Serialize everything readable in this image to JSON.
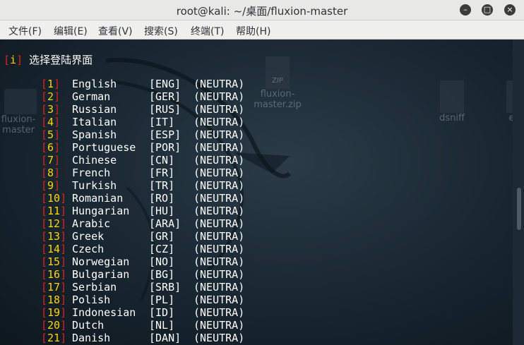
{
  "window": {
    "title": "root@kali: ~/桌面/fluxion-master"
  },
  "menu": [
    "文件(F)",
    "编辑(E)",
    "查看(V)",
    "搜索(S)",
    "终端(T)",
    "帮助(H)"
  ],
  "desktop_icons": [
    {
      "label": "fluxion-master"
    },
    {
      "label": "fluxion-master.zip"
    },
    {
      "label": "dsniff"
    },
    {
      "label": "et"
    }
  ],
  "terminal": {
    "header": {
      "tag": "i",
      "text": "选择登陆界面"
    },
    "languages": [
      {
        "num": "1",
        "name": "English",
        "code": "[ENG]",
        "status": "(NEUTRA)"
      },
      {
        "num": "2",
        "name": "German",
        "code": "[GER]",
        "status": "(NEUTRA)"
      },
      {
        "num": "3",
        "name": "Russian",
        "code": "[RUS]",
        "status": "(NEUTRA)"
      },
      {
        "num": "4",
        "name": "Italian",
        "code": "[IT]",
        "status": "(NEUTRA)"
      },
      {
        "num": "5",
        "name": "Spanish",
        "code": "[ESP]",
        "status": "(NEUTRA)"
      },
      {
        "num": "6",
        "name": "Portuguese",
        "code": "[POR]",
        "status": "(NEUTRA)"
      },
      {
        "num": "7",
        "name": "Chinese",
        "code": "[CN]",
        "status": "(NEUTRA)"
      },
      {
        "num": "8",
        "name": "French",
        "code": "[FR]",
        "status": "(NEUTRA)"
      },
      {
        "num": "9",
        "name": "Turkish",
        "code": "[TR]",
        "status": "(NEUTRA)"
      },
      {
        "num": "10",
        "name": "Romanian",
        "code": "[RO]",
        "status": "(NEUTRA)"
      },
      {
        "num": "11",
        "name": "Hungarian",
        "code": "[HU]",
        "status": "(NEUTRA)"
      },
      {
        "num": "12",
        "name": "Arabic",
        "code": "[ARA]",
        "status": "(NEUTRA)"
      },
      {
        "num": "13",
        "name": "Greek",
        "code": "[GR]",
        "status": "(NEUTRA)"
      },
      {
        "num": "14",
        "name": "Czech",
        "code": "[CZ]",
        "status": "(NEUTRA)"
      },
      {
        "num": "15",
        "name": "Norwegian",
        "code": "[NO]",
        "status": "(NEUTRA)"
      },
      {
        "num": "16",
        "name": "Bulgarian",
        "code": "[BG]",
        "status": "(NEUTRA)"
      },
      {
        "num": "17",
        "name": "Serbian",
        "code": "[SRB]",
        "status": "(NEUTRA)"
      },
      {
        "num": "18",
        "name": "Polish",
        "code": "[PL]",
        "status": "(NEUTRA)"
      },
      {
        "num": "19",
        "name": "Indonesian",
        "code": "[ID]",
        "status": "(NEUTRA)"
      },
      {
        "num": "20",
        "name": "Dutch",
        "code": "[NL]",
        "status": "(NEUTRA)"
      },
      {
        "num": "21",
        "name": "Danish",
        "code": "[DAN]",
        "status": "(NEUTRA)"
      }
    ]
  }
}
